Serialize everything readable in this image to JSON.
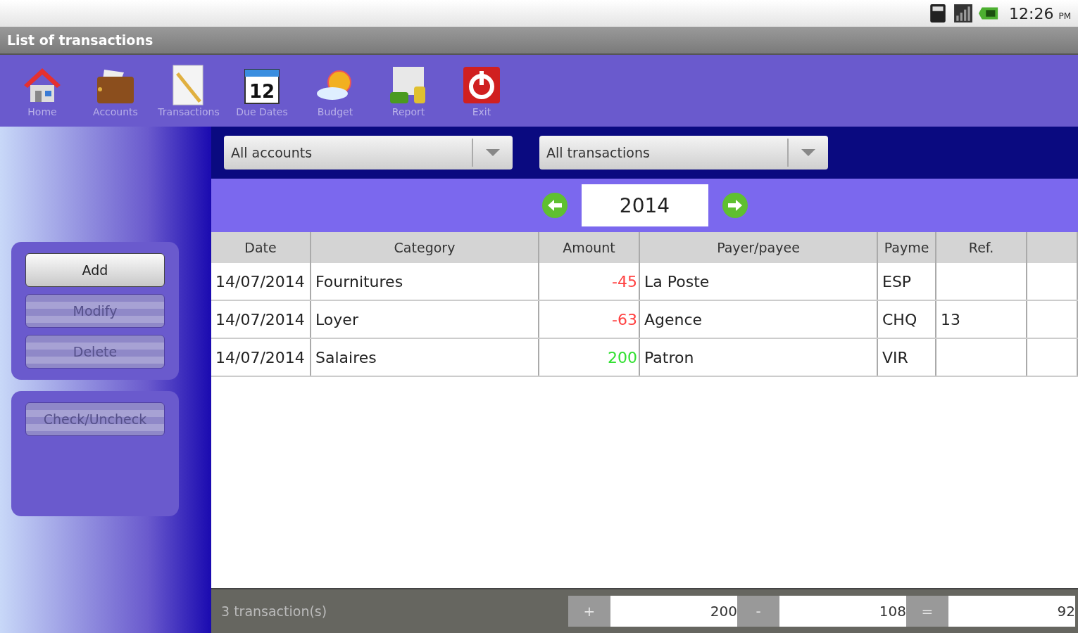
{
  "status_bar": {
    "time": "12:26",
    "ampm": "PM"
  },
  "window": {
    "title": "List of transactions"
  },
  "toolbar": [
    {
      "kind": "home",
      "label": "Home"
    },
    {
      "kind": "wallet",
      "label": "Accounts"
    },
    {
      "kind": "notepad",
      "label": "Transactions"
    },
    {
      "kind": "calendar",
      "label": "Due Dates",
      "day": "12"
    },
    {
      "kind": "weather",
      "label": "Budget"
    },
    {
      "kind": "report",
      "label": "Report"
    },
    {
      "kind": "power",
      "label": "Exit"
    }
  ],
  "sidebar": {
    "groups": [
      [
        {
          "label": "Add",
          "disabled": false
        },
        {
          "label": "Modify",
          "disabled": true
        },
        {
          "label": "Delete",
          "disabled": true
        }
      ],
      [
        {
          "label": "Check/Uncheck",
          "disabled": true
        }
      ]
    ]
  },
  "filters": [
    {
      "value": "All accounts"
    },
    {
      "value": "All transactions"
    }
  ],
  "year": "2014",
  "table": {
    "columns": [
      "Date",
      "Category",
      "Amount",
      "Payer/payee",
      "Payme",
      "Ref."
    ],
    "rows": [
      {
        "date": "14/07/2014",
        "category": "Fournitures",
        "amount": "-45",
        "color": "#ff4040",
        "payee": "La Poste",
        "payment": "ESP"
      },
      {
        "date": "14/07/2014",
        "category": "Loyer",
        "amount": "-63",
        "color": "#ff4040",
        "payee": "Agence",
        "payment": "CHQ",
        "ref": "13"
      },
      {
        "date": "14/07/2014",
        "category": "Salaires",
        "amount": "200",
        "color": "#30e030",
        "payee": "Patron",
        "payment": "VIR"
      }
    ]
  },
  "footer": {
    "count": "3 transaction(s)",
    "totals": [
      {
        "sign": "+",
        "value": "200"
      },
      {
        "sign": "-",
        "value": "108"
      },
      {
        "sign": "=",
        "value": "92"
      }
    ]
  }
}
